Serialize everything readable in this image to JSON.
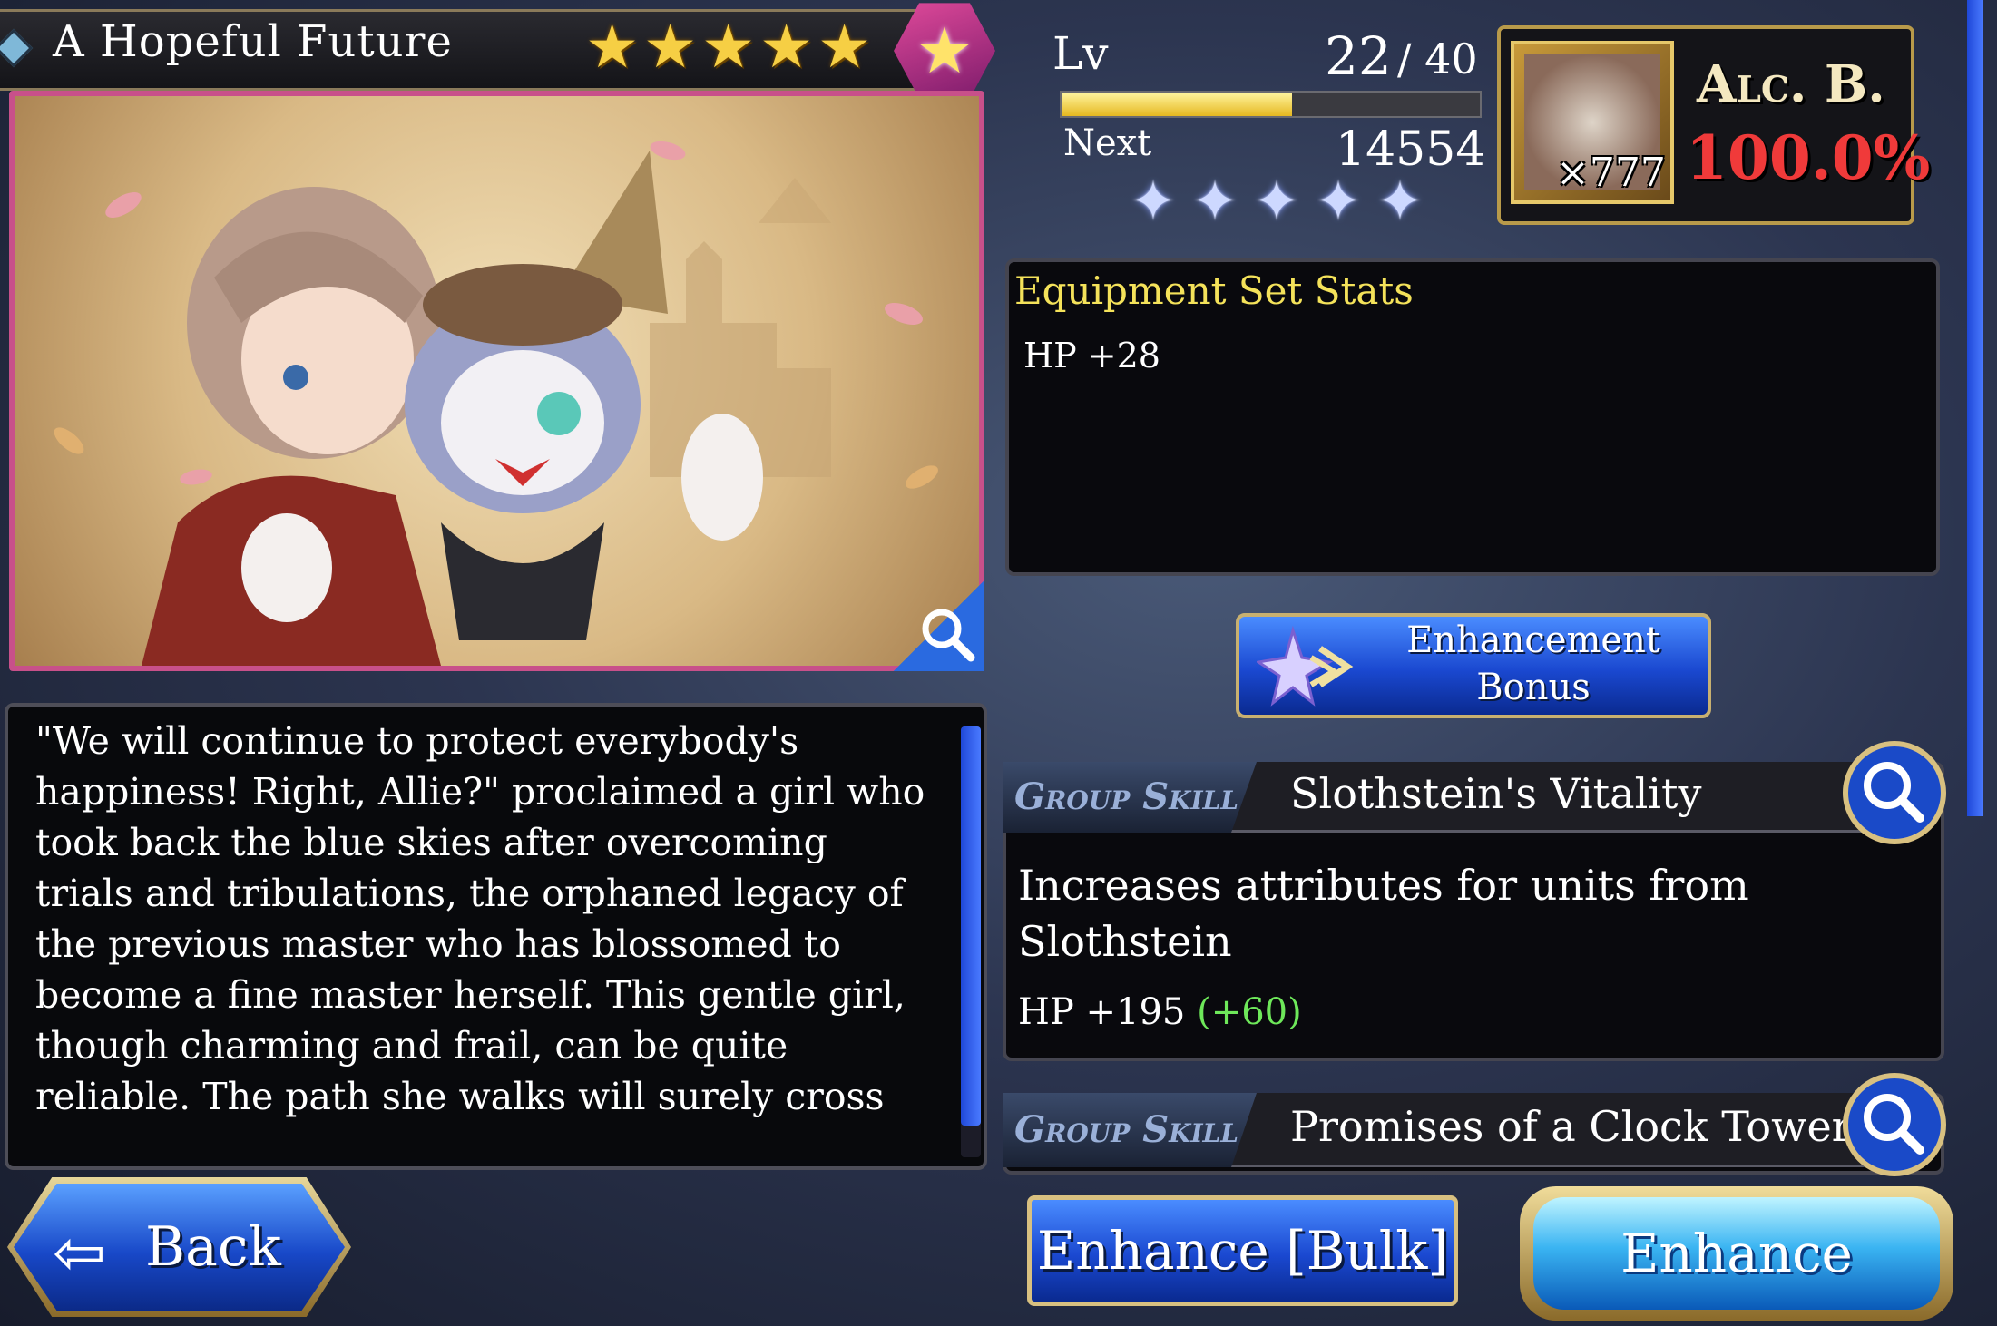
{
  "header": {
    "title": "A Hopeful Future",
    "rarity_stars": 5,
    "star_glyph": "★"
  },
  "description": {
    "text": "\"We will continue to protect everybody's\nhappiness! Right, Allie?\" proclaimed a girl who\ntook back the blue skies after overcoming\ntrials and tribulations, the orphaned legacy of\nthe previous master who has blossomed to\nbecome a fine master herself. This gentle girl,\nthough charming and frail, can be quite\nreliable. The path she walks will surely cross"
  },
  "level": {
    "label": "Lv",
    "current": "22",
    "max": "/ 40",
    "exp_fraction": 0.55,
    "next_label": "Next",
    "next_value": "14554",
    "enhancement_stars": 5,
    "enhancement_star_glyph": "✦"
  },
  "alchemy": {
    "count": "×777",
    "label": "Alc. B.",
    "value": "100.0%"
  },
  "equipment_set": {
    "title": "Equipment Set Stats",
    "line": "HP +28"
  },
  "enhancement_bonus_button": {
    "label": "Enhancement\nBonus"
  },
  "skills": [
    {
      "tag": "Group Skill",
      "name": "Slothstein's Vitality",
      "description": "Increases attributes for units from\nSlothstein",
      "stat": "HP +195",
      "stat_bonus": "(+60)"
    },
    {
      "tag": "Group Skill",
      "name": "Promises of a Clock Tower"
    }
  ],
  "buttons": {
    "back": "Back",
    "enhance_bulk": "Enhance [Bulk]",
    "enhance": "Enhance"
  },
  "colors": {
    "accent_yellow": "#f4e25a",
    "bonus_green": "#6ee85a",
    "alc_red": "#f03a3a",
    "button_blue": "#1a48d0"
  }
}
